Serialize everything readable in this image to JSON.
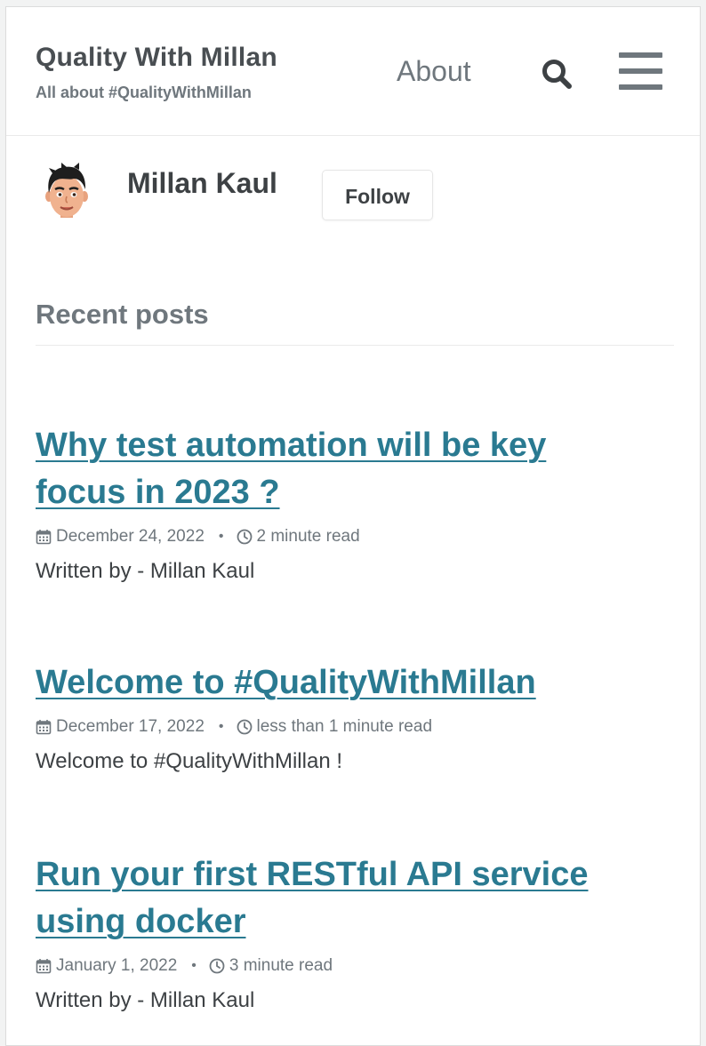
{
  "masthead": {
    "site_title": "Quality With Millan",
    "site_subtitle": "All about #QualityWithMillan",
    "nav_about": "About",
    "search_icon": "search-icon",
    "menu_icon": "hamburger-menu-icon"
  },
  "author": {
    "name": "Millan Kaul",
    "follow_label": "Follow",
    "avatar_icon": "avatar-icon"
  },
  "recent": {
    "heading": "Recent posts"
  },
  "posts": [
    {
      "title_line1": "Why test automation will be key",
      "title_line2": "focus in 2023 ?",
      "date": "December 24, 2022",
      "read_time": "2 minute read",
      "excerpt": "Written by - Millan Kaul"
    },
    {
      "title_line1": "Welcome to #QualityWithMillan",
      "date": "December 17, 2022",
      "read_time": "less than 1 minute read",
      "excerpt": "Welcome to #QualityWithMillan !"
    },
    {
      "title_line1": "Run your first RESTful API service",
      "title_line2": "using docker",
      "date": "January 1, 2022",
      "read_time": "3 minute read",
      "excerpt": "Written by - Millan Kaul"
    }
  ],
  "meta_separator": "•",
  "colors": {
    "link": "#2a7a91",
    "text": "#3d4144",
    "muted": "#6f777d",
    "background": "#ffffff"
  }
}
